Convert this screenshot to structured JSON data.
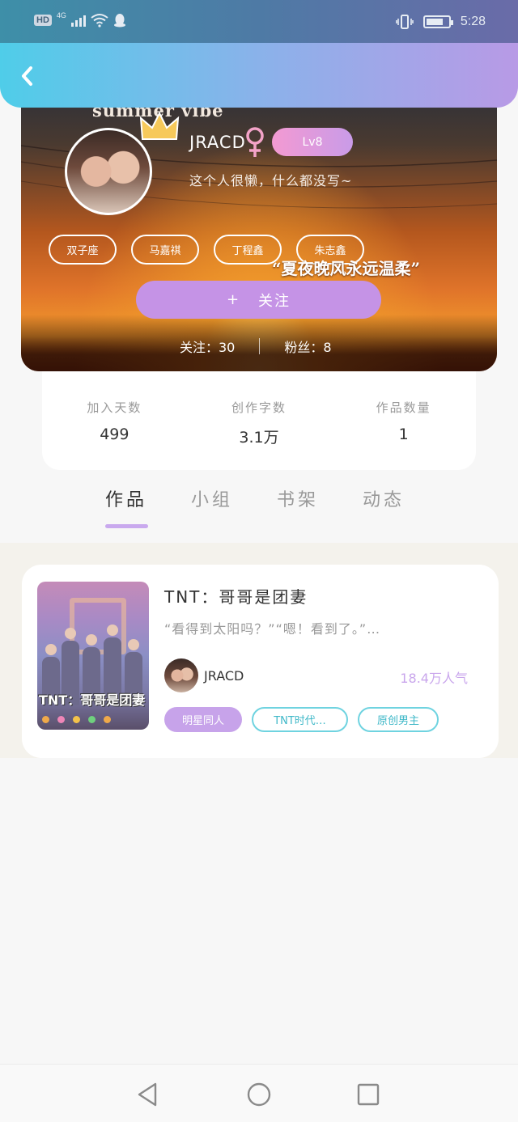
{
  "status_bar": {
    "hd_label": "HD",
    "signal_label": "4G",
    "time": "5:28"
  },
  "header": {
    "back_icon": "chevron-left-icon"
  },
  "profile": {
    "banner_text": "summer vibe",
    "username": "JRACD",
    "gender_icon": "female-icon",
    "level": "Lv8",
    "bio": "这个人很懒，什么都没写~",
    "tags": [
      "双子座",
      "马嘉祺",
      "丁程鑫",
      "朱志鑫"
    ],
    "banner_quote": "“夏夜晚风永远温柔”",
    "follow_button": {
      "plus": "+",
      "label": "关注"
    },
    "following": "关注：30",
    "fans": "粉丝：8"
  },
  "stats": [
    {
      "label": "加入天数",
      "value": "499"
    },
    {
      "label": "创作字数",
      "value": "3.1万"
    },
    {
      "label": "作品数量",
      "value": "1"
    }
  ],
  "tabs": [
    {
      "label": "作品",
      "active": true
    },
    {
      "label": "小组",
      "active": false
    },
    {
      "label": "书架",
      "active": false
    },
    {
      "label": "动态",
      "active": false
    }
  ],
  "work": {
    "cover_text": "TNT：哥哥是团妻",
    "title": "TNT：哥哥是团妻",
    "excerpt": "“看得到太阳吗？”“嗯！看到了。”…",
    "author": "JRACD",
    "popularity": "18.4万人气",
    "tags": [
      "明星同人",
      "TNT时代…",
      "原创男主"
    ]
  },
  "colors": {
    "accent_purple": "#c593e6",
    "tag_cyan": "#6fd3e0",
    "popularity": "#c9a6ec"
  }
}
